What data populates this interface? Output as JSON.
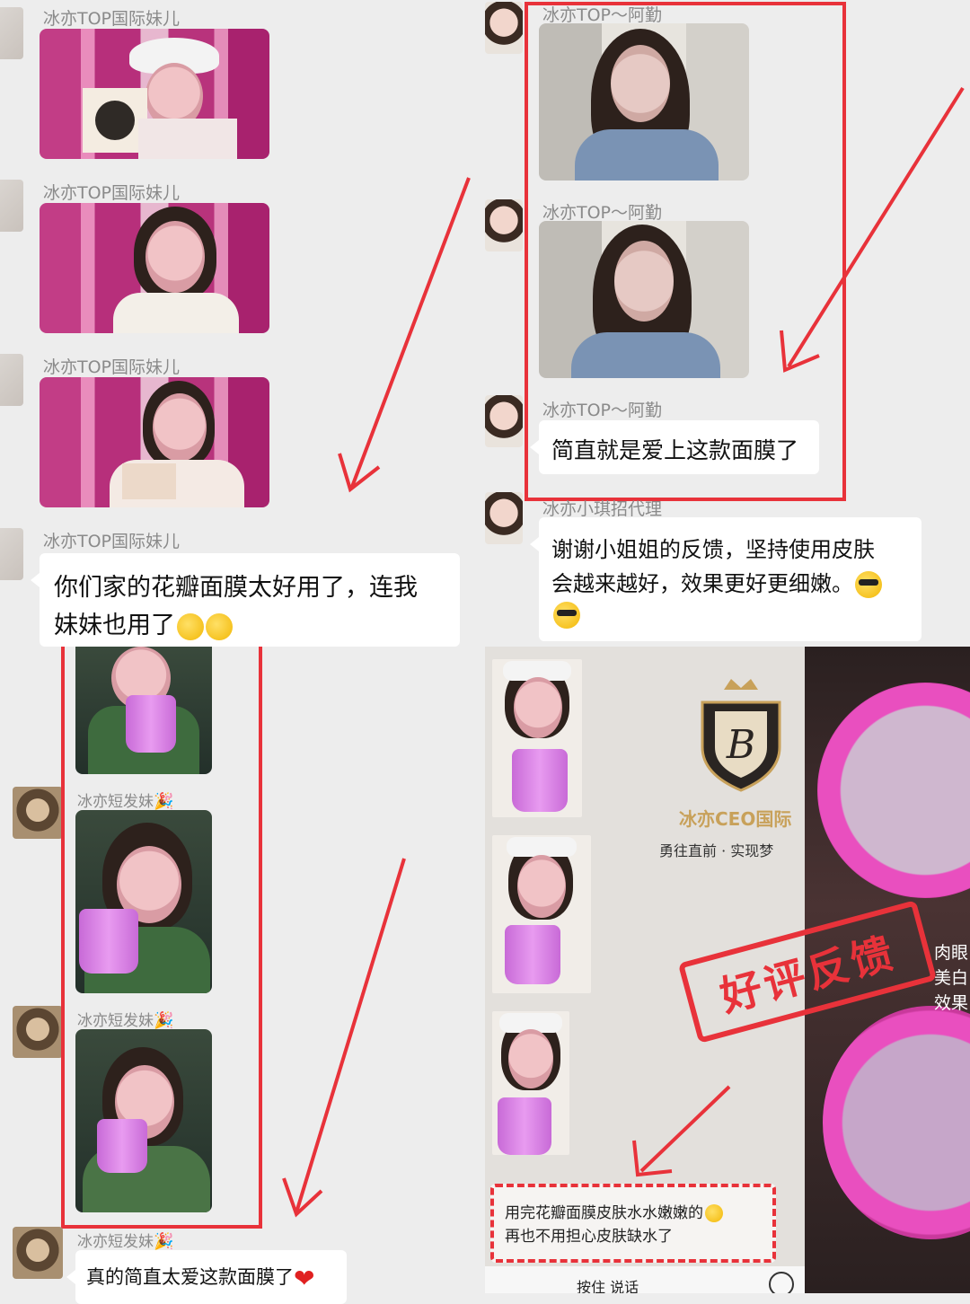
{
  "left_chat": {
    "sender_1": "冰亦TOP国际妹儿",
    "sender_2": "冰亦TOP国际妹儿",
    "sender_3": "冰亦TOP国际妹儿",
    "sender_4": "冰亦TOP国际妹儿",
    "message_1_line1": "你们家的花瓣面膜太好用了，连我",
    "message_1_line2": "妹妹也用了",
    "sender_5": "冰亦短发妹",
    "sender_6": "冰亦短发妹",
    "sender_7": "冰亦短发妹",
    "message_2": "真的简直太爱这款面膜了"
  },
  "right_chat": {
    "sender_1": "冰亦TOP～阿勤",
    "sender_2": "冰亦TOP～阿勤",
    "sender_3": "冰亦TOP～阿勤",
    "message_1": "简直就是爱上这款面膜了",
    "sender_4": "冰亦小琪招代理",
    "message_2_line1": "谢谢小姐姐的反馈，坚持使用皮肤",
    "message_2_line2": "会越来越好，效果更好更细嫩。"
  },
  "promo": {
    "brand": "冰亦CEO国际",
    "slogan": "勇往直前 · 实现梦",
    "stamp": "好评反馈",
    "side_text_1": "肉眼",
    "side_text_2": "美白",
    "side_text_3": "效果",
    "review_line1": "用完花瓣面膜皮肤水水嫩嫩的",
    "review_line2": "再也不用担心皮肤缺水了",
    "bottom_text": "按住 说话"
  },
  "colors": {
    "accent_red": "#e8323a",
    "background": "#ededed",
    "bubble": "#ffffff"
  },
  "icons": [
    "thinking-emoji",
    "sunglasses-emoji",
    "heart-emoji",
    "party-emoji",
    "crown-logo",
    "arrow-icon"
  ]
}
